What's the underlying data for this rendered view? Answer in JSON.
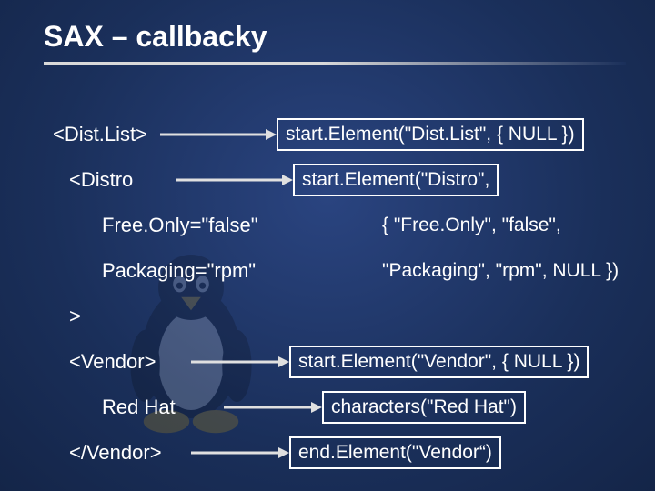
{
  "title": "SAX – callbacky",
  "rows": [
    {
      "xml": "<Dist.List>",
      "indent": 0,
      "callback": "start.Element(\"Dist.List\", { NULL })",
      "boxed": true,
      "arrow": true
    },
    {
      "xml": "<Distro",
      "indent": 1,
      "callback": "start.Element(\"Distro\",",
      "boxed": true,
      "arrow": true
    },
    {
      "xml": "Free.Only=\"false\"",
      "indent": 2,
      "callback": "{ \"Free.Only\", \"false\",",
      "boxed": false,
      "arrow": false
    },
    {
      "xml": "Packaging=\"rpm\"",
      "indent": 2,
      "callback": "\"Packaging\", \"rpm\", NULL })",
      "boxed": false,
      "arrow": false
    },
    {
      "xml": ">",
      "indent": 1,
      "callback": "",
      "boxed": false,
      "arrow": false
    },
    {
      "xml": "<Vendor>",
      "indent": 1,
      "callback": "start.Element(\"Vendor\", { NULL })",
      "boxed": true,
      "arrow": true
    },
    {
      "xml": "Red Hat",
      "indent": 2,
      "callback": "characters(\"Red Hat\")",
      "boxed": true,
      "arrow": true
    },
    {
      "xml": "</Vendor>",
      "indent": 1,
      "callback": "end.Element(\"Vendor“)",
      "boxed": true,
      "arrow": true
    }
  ]
}
